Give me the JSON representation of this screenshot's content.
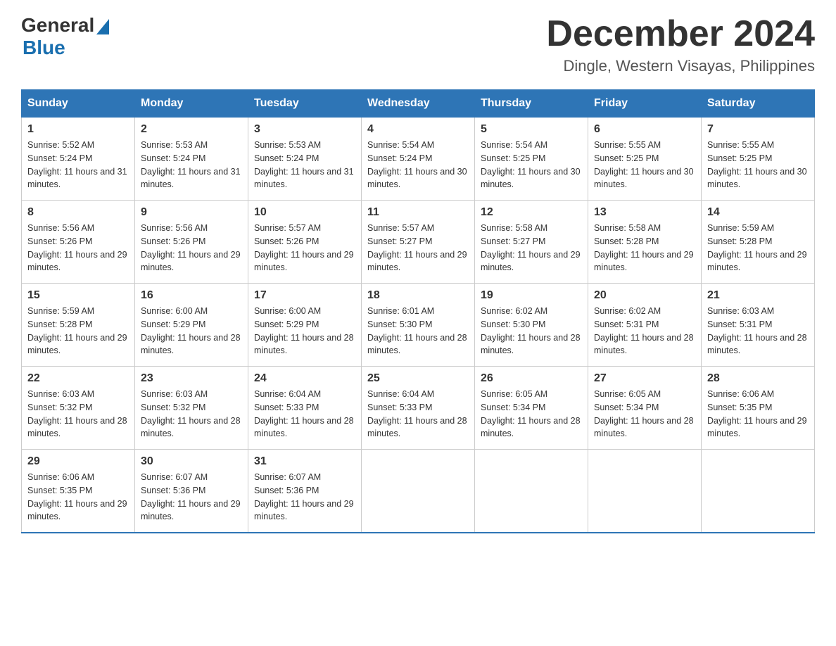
{
  "header": {
    "logo_general": "General",
    "logo_blue": "Blue",
    "month_title": "December 2024",
    "location": "Dingle, Western Visayas, Philippines"
  },
  "days_of_week": [
    "Sunday",
    "Monday",
    "Tuesday",
    "Wednesday",
    "Thursday",
    "Friday",
    "Saturday"
  ],
  "weeks": [
    [
      {
        "day": "1",
        "sunrise": "5:52 AM",
        "sunset": "5:24 PM",
        "daylight": "11 hours and 31 minutes."
      },
      {
        "day": "2",
        "sunrise": "5:53 AM",
        "sunset": "5:24 PM",
        "daylight": "11 hours and 31 minutes."
      },
      {
        "day": "3",
        "sunrise": "5:53 AM",
        "sunset": "5:24 PM",
        "daylight": "11 hours and 31 minutes."
      },
      {
        "day": "4",
        "sunrise": "5:54 AM",
        "sunset": "5:24 PM",
        "daylight": "11 hours and 30 minutes."
      },
      {
        "day": "5",
        "sunrise": "5:54 AM",
        "sunset": "5:25 PM",
        "daylight": "11 hours and 30 minutes."
      },
      {
        "day": "6",
        "sunrise": "5:55 AM",
        "sunset": "5:25 PM",
        "daylight": "11 hours and 30 minutes."
      },
      {
        "day": "7",
        "sunrise": "5:55 AM",
        "sunset": "5:25 PM",
        "daylight": "11 hours and 30 minutes."
      }
    ],
    [
      {
        "day": "8",
        "sunrise": "5:56 AM",
        "sunset": "5:26 PM",
        "daylight": "11 hours and 29 minutes."
      },
      {
        "day": "9",
        "sunrise": "5:56 AM",
        "sunset": "5:26 PM",
        "daylight": "11 hours and 29 minutes."
      },
      {
        "day": "10",
        "sunrise": "5:57 AM",
        "sunset": "5:26 PM",
        "daylight": "11 hours and 29 minutes."
      },
      {
        "day": "11",
        "sunrise": "5:57 AM",
        "sunset": "5:27 PM",
        "daylight": "11 hours and 29 minutes."
      },
      {
        "day": "12",
        "sunrise": "5:58 AM",
        "sunset": "5:27 PM",
        "daylight": "11 hours and 29 minutes."
      },
      {
        "day": "13",
        "sunrise": "5:58 AM",
        "sunset": "5:28 PM",
        "daylight": "11 hours and 29 minutes."
      },
      {
        "day": "14",
        "sunrise": "5:59 AM",
        "sunset": "5:28 PM",
        "daylight": "11 hours and 29 minutes."
      }
    ],
    [
      {
        "day": "15",
        "sunrise": "5:59 AM",
        "sunset": "5:28 PM",
        "daylight": "11 hours and 29 minutes."
      },
      {
        "day": "16",
        "sunrise": "6:00 AM",
        "sunset": "5:29 PM",
        "daylight": "11 hours and 28 minutes."
      },
      {
        "day": "17",
        "sunrise": "6:00 AM",
        "sunset": "5:29 PM",
        "daylight": "11 hours and 28 minutes."
      },
      {
        "day": "18",
        "sunrise": "6:01 AM",
        "sunset": "5:30 PM",
        "daylight": "11 hours and 28 minutes."
      },
      {
        "day": "19",
        "sunrise": "6:02 AM",
        "sunset": "5:30 PM",
        "daylight": "11 hours and 28 minutes."
      },
      {
        "day": "20",
        "sunrise": "6:02 AM",
        "sunset": "5:31 PM",
        "daylight": "11 hours and 28 minutes."
      },
      {
        "day": "21",
        "sunrise": "6:03 AM",
        "sunset": "5:31 PM",
        "daylight": "11 hours and 28 minutes."
      }
    ],
    [
      {
        "day": "22",
        "sunrise": "6:03 AM",
        "sunset": "5:32 PM",
        "daylight": "11 hours and 28 minutes."
      },
      {
        "day": "23",
        "sunrise": "6:03 AM",
        "sunset": "5:32 PM",
        "daylight": "11 hours and 28 minutes."
      },
      {
        "day": "24",
        "sunrise": "6:04 AM",
        "sunset": "5:33 PM",
        "daylight": "11 hours and 28 minutes."
      },
      {
        "day": "25",
        "sunrise": "6:04 AM",
        "sunset": "5:33 PM",
        "daylight": "11 hours and 28 minutes."
      },
      {
        "day": "26",
        "sunrise": "6:05 AM",
        "sunset": "5:34 PM",
        "daylight": "11 hours and 28 minutes."
      },
      {
        "day": "27",
        "sunrise": "6:05 AM",
        "sunset": "5:34 PM",
        "daylight": "11 hours and 28 minutes."
      },
      {
        "day": "28",
        "sunrise": "6:06 AM",
        "sunset": "5:35 PM",
        "daylight": "11 hours and 29 minutes."
      }
    ],
    [
      {
        "day": "29",
        "sunrise": "6:06 AM",
        "sunset": "5:35 PM",
        "daylight": "11 hours and 29 minutes."
      },
      {
        "day": "30",
        "sunrise": "6:07 AM",
        "sunset": "5:36 PM",
        "daylight": "11 hours and 29 minutes."
      },
      {
        "day": "31",
        "sunrise": "6:07 AM",
        "sunset": "5:36 PM",
        "daylight": "11 hours and 29 minutes."
      },
      null,
      null,
      null,
      null
    ]
  ]
}
